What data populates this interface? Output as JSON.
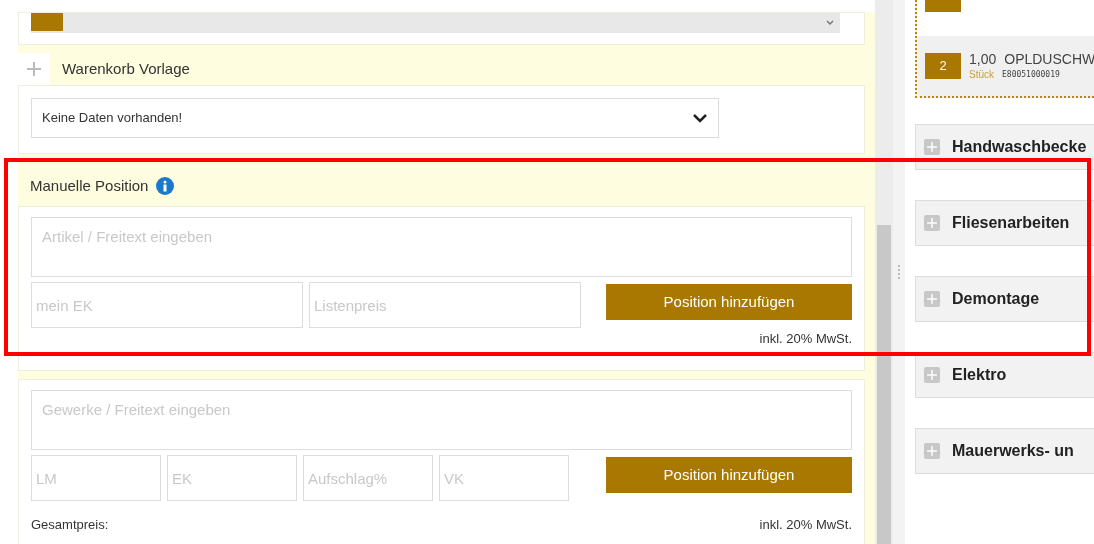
{
  "warenkorb": {
    "title": "Warenkorb Vorlage",
    "expanded": false,
    "select": {
      "value": "Keine Daten vorhanden!"
    }
  },
  "manual_position": {
    "title": "Manuelle Position",
    "article": {
      "placeholder": "Artikel / Freitext eingeben"
    },
    "fields": [
      {
        "placeholder": "mein EK"
      },
      {
        "placeholder": "Listenpreis"
      }
    ],
    "button": "Position hinzufügen",
    "tax_note": "inkl. 20% MwSt."
  },
  "trade_position": {
    "article": {
      "placeholder": "Gewerke / Freitext eingeben"
    },
    "fields": [
      {
        "placeholder": "LM"
      },
      {
        "placeholder": "EK"
      },
      {
        "placeholder": "Aufschlag%"
      },
      {
        "placeholder": "VK"
      }
    ],
    "button": "Position hinzufügen",
    "total_label": "Gesamtpreis:",
    "tax_note": "inkl. 20% MwSt."
  },
  "cart_items": [
    {
      "number": "2",
      "quantity": "1,00",
      "unit": "Stück",
      "code": "E80051000019",
      "name": "OPLDUSCHW"
    }
  ],
  "categories": [
    {
      "title": "Handwaschbecke",
      "expanded": false
    },
    {
      "title": "Fliesenarbeiten",
      "expanded": false
    },
    {
      "title": "Demontage",
      "expanded": false
    },
    {
      "title": "Elektro",
      "expanded": false
    },
    {
      "title": "Mauerwerks- un",
      "expanded": false
    }
  ]
}
